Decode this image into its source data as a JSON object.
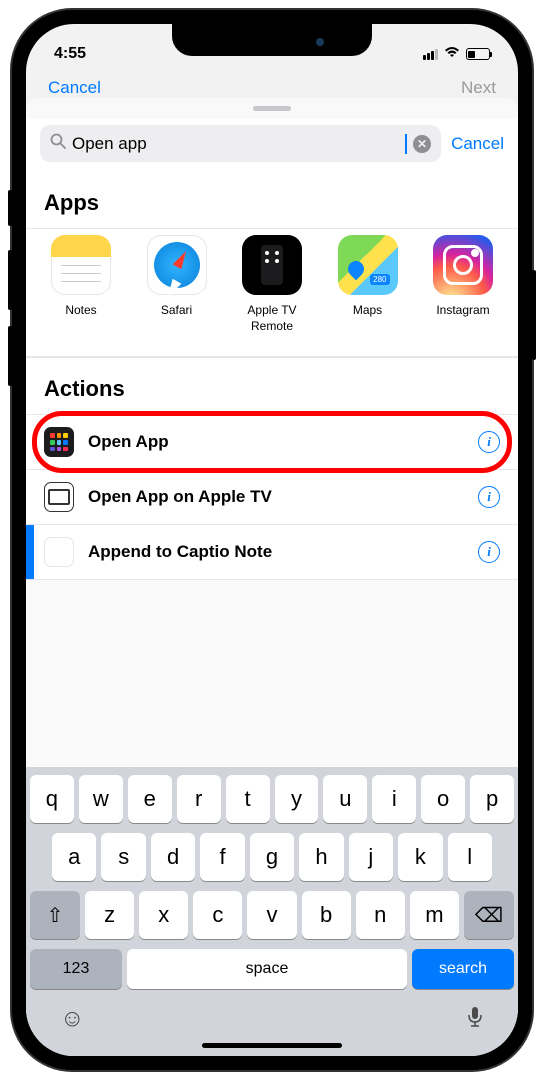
{
  "status": {
    "time": "4:55"
  },
  "nav_hidden": {
    "left": "Cancel",
    "right": "Next"
  },
  "search": {
    "value": "Open app",
    "cancel": "Cancel"
  },
  "sections": {
    "apps": "Apps",
    "actions": "Actions"
  },
  "apps": [
    {
      "label": "Notes"
    },
    {
      "label": "Safari"
    },
    {
      "label": "Apple TV Remote"
    },
    {
      "label": "Maps"
    },
    {
      "label": "Instagram"
    }
  ],
  "actions": [
    {
      "label": "Open App",
      "highlighted": true
    },
    {
      "label": "Open App on Apple TV",
      "highlighted": false
    },
    {
      "label": "Append to Captio Note",
      "highlighted": false
    }
  ],
  "keyboard": {
    "row1": [
      "q",
      "w",
      "e",
      "r",
      "t",
      "y",
      "u",
      "i",
      "o",
      "p"
    ],
    "row2": [
      "a",
      "s",
      "d",
      "f",
      "g",
      "h",
      "j",
      "k",
      "l"
    ],
    "row3": [
      "z",
      "x",
      "c",
      "v",
      "b",
      "n",
      "m"
    ],
    "numKey": "123",
    "space": "space",
    "search": "search"
  }
}
